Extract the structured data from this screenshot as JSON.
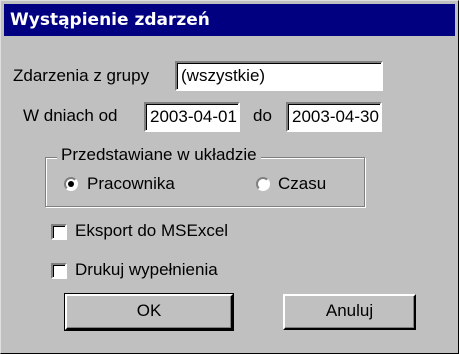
{
  "window": {
    "title": "Wystąpienie zdarzeń"
  },
  "group": {
    "label": "Zdarzenia z grupy",
    "value": "(wszystkie)"
  },
  "dates": {
    "from_label": "W dniach od",
    "from_value": "2003-04-01",
    "to_label": "do",
    "to_value": "2003-04-30"
  },
  "layout_group": {
    "legend": "Przedstawiane w układzie",
    "options": [
      {
        "label": "Pracownika",
        "selected": true
      },
      {
        "label": "Czasu",
        "selected": false
      }
    ]
  },
  "checkboxes": [
    {
      "label": "Eksport do MSExcel",
      "checked": false
    },
    {
      "label": "Drukuj wypełnienia",
      "checked": false
    }
  ],
  "buttons": {
    "ok_label": "OK",
    "cancel_label": "Anuluj"
  },
  "colors": {
    "title_bar": "#000080",
    "face": "#c0c0c0"
  }
}
